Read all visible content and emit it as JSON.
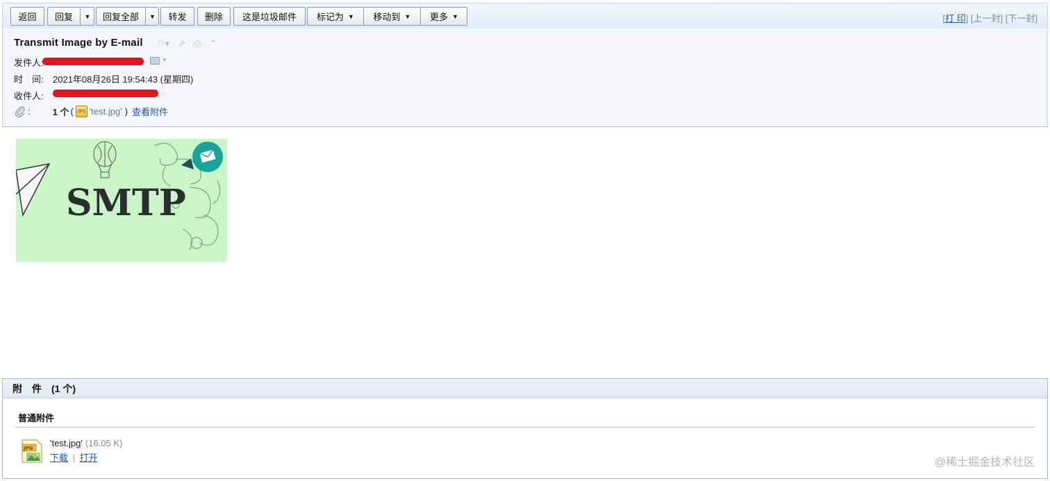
{
  "toolbar": {
    "back": "返回",
    "reply": "回复",
    "reply_all": "回复全部",
    "forward": "转发",
    "delete": "删除",
    "spam": "这是垃圾邮件",
    "mark_as": "标记为",
    "move_to": "移动到",
    "more": "更多",
    "print": "打 印",
    "prev": "上一封",
    "next": "下一封"
  },
  "email": {
    "subject": "Transmit Image by E-mail",
    "from_label": "发件人:",
    "time_label": "时　间:",
    "time_value": "2021年08月26日 19:54:43 (星期四)",
    "to_label": "收件人:",
    "attach_count": "1 个",
    "attach_file": "'test.jpg'",
    "view_attachments": "查看附件"
  },
  "body_image": {
    "text": "SMTP",
    "background": "#c9f5c9"
  },
  "attachments": {
    "title": "附　件　(1 个)",
    "section": "普通附件",
    "file_name": "'test.jpg'",
    "file_size": "(16.05 K)",
    "download": "下载",
    "open": "打开",
    "separator": "|"
  },
  "watermark": "@稀土掘金技术社区",
  "icons": {
    "flag": "flag-icon",
    "popout": "popout-icon",
    "print": "print-icon",
    "collapse": "collapse-icon",
    "paperclip": "paperclip-icon",
    "contact": "contact-card-icon",
    "jpg": "jpg-file-icon"
  }
}
